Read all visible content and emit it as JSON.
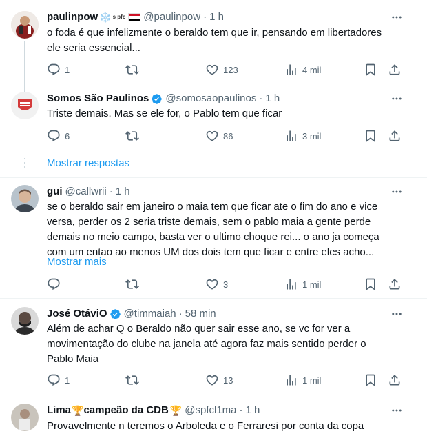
{
  "tweets": [
    {
      "name": "paulinpow",
      "name_emoji": "❄️",
      "name_suffix": "s pfc",
      "handle": "@paulinpow",
      "time": "1 h",
      "text": "o foda é que infelizmente o beraldo tem que ir, pensando em libertadores ele seria essencial...",
      "replies": "1",
      "retweets": "",
      "likes": "123",
      "views": "4 mil"
    },
    {
      "name": "Somos São Paulinos",
      "verified": true,
      "handle": "@somosaopaulinos",
      "time": "1 h",
      "text": "Triste demais. Mas se ele for, o Pablo tem que ficar",
      "replies": "6",
      "retweets": "",
      "likes": "86",
      "views": "3 mil"
    },
    {
      "name": "gui",
      "handle": "@callwrii",
      "time": "1 h",
      "text": "se o beraldo sair em janeiro o maia tem que ficar ate o fim do ano e vice versa, perder os 2 seria triste demais, sem o pablo maia a gente perde demais no meio campo, basta ver o ultimo choque rei... o ano ja começa com um entao ao menos UM dos dois tem que ficar e entre eles acho...",
      "show_more": "Mostrar mais",
      "replies": "",
      "retweets": "",
      "likes": "3",
      "views": "1 mil"
    },
    {
      "name": "José OtáviO",
      "verified": true,
      "handle": "@timmaiah",
      "time": "58 min",
      "text": "Além de achar Q o Beraldo não quer sair esse ano, se vc for ver a movimentação do clube na janela até agora faz mais sentido perder o Pablo Maia",
      "replies": "1",
      "retweets": "",
      "likes": "13",
      "views": "1 mil"
    },
    {
      "name_prefix": "Lima",
      "name_trophy1": "🏆",
      "name_main": "campeão da CDB",
      "name_trophy2": "🏆",
      "handle": "@spfcl1ma",
      "time": "1 h",
      "text": "Provavelmente n teremos o Arboleda e o Ferraresi por conta da copa"
    }
  ],
  "show_replies_label": "Mostrar respostas",
  "colors": {
    "accent": "#1d9bf0",
    "muted": "#536471",
    "text": "#0f1419",
    "verified": "#1d9bf0",
    "divider": "#eff3f4"
  },
  "icons": [
    "more-icon",
    "reply-icon",
    "retweet-icon",
    "like-icon",
    "views-icon",
    "bookmark-icon",
    "share-icon",
    "verified-badge-icon"
  ]
}
